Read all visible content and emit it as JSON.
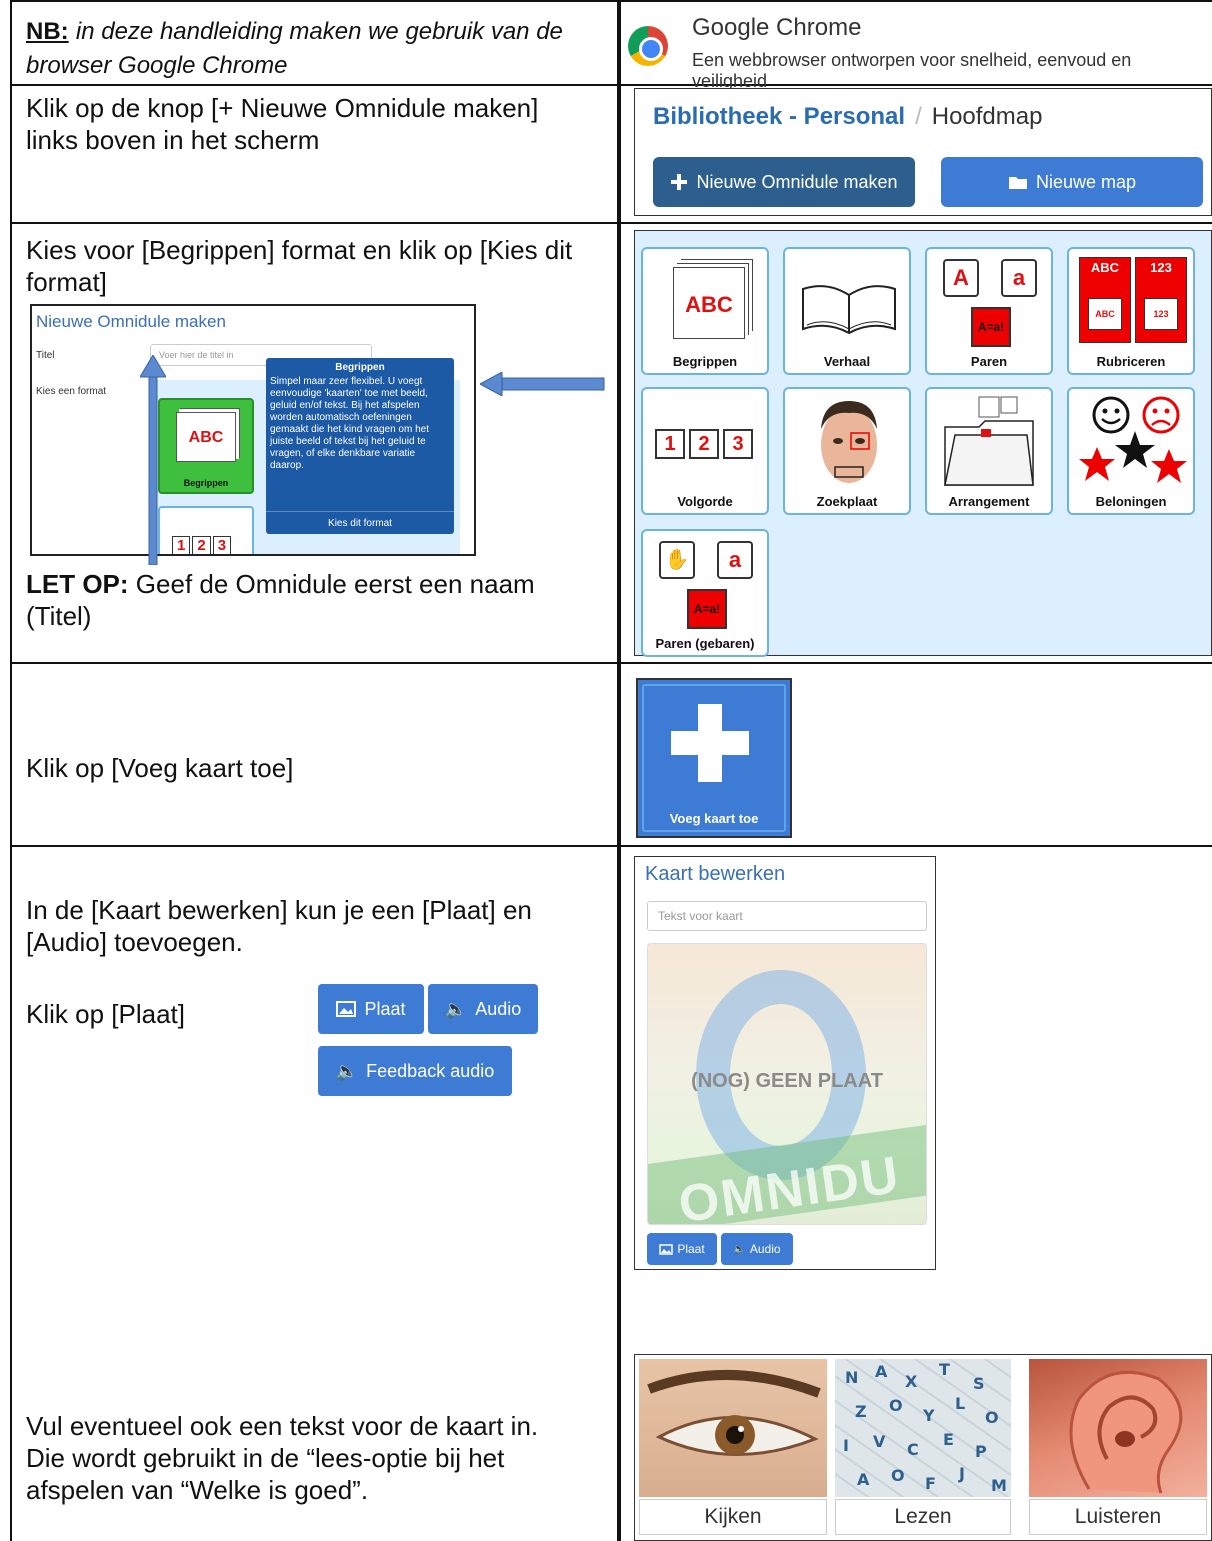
{
  "row1": {
    "nb_label": "NB:",
    "nb_text_line1": "in deze handleiding maken we gebruik van de",
    "nb_text_line2": "browser Google Chrome",
    "chrome_title": "Google Chrome",
    "chrome_subtitle": "Een webbrowser ontworpen voor snelheid, eenvoud en veiligheid"
  },
  "row2": {
    "instruction_line1": "Klik op de knop [+ Nieuwe Omnidule maken]",
    "instruction_line2": "links boven in het scherm",
    "breadcrumb_library": "Bibliotheek - Personal",
    "breadcrumb_sep": "/",
    "breadcrumb_current": "Hoofdmap",
    "new_omnidule_button": "Nieuwe Omnidule maken",
    "new_folder_button": "Nieuwe map"
  },
  "row3": {
    "instruction_line1": "Kies voor [Begrippen] format en klik op [Kies dit",
    "instruction_line2": "format]",
    "note_label": "LET OP:",
    "note_text_line1": "Geef de Omnidule eerst een naam",
    "note_text_line2": "(Titel)",
    "mini_title": "Nieuwe Omnidule maken",
    "mini_label_title": "Titel",
    "mini_placeholder": "Voer hier de titel in",
    "mini_label_format": "Kies een format",
    "mini_card_label": "Begrippen",
    "mini_card_text": "ABC",
    "mini_numbers": [
      "1",
      "2",
      "3"
    ],
    "tooltip_title": "Begrippen",
    "tooltip_body": "Simpel maar zeer flexibel. U voegt eenvoudige 'kaarten' toe met beeld, geluid en/of tekst. Bij het afspelen worden automatisch oefeningen gemaakt die het kind vragen om het juiste beeld of tekst bij het geluid te vragen, of elke denkbare variatie daarop.",
    "tooltip_button": "Kies dit format",
    "formats": [
      {
        "label": "Begrippen",
        "icon": "abc-cards-icon"
      },
      {
        "label": "Verhaal",
        "icon": "open-book-icon"
      },
      {
        "label": "Paren",
        "icon": "pairs-icon"
      },
      {
        "label": "Rubriceren",
        "icon": "categorize-icon"
      },
      {
        "label": "Volgorde",
        "icon": "sequence-icon"
      },
      {
        "label": "Zoekplaat",
        "icon": "face-search-icon"
      },
      {
        "label": "Arrangement",
        "icon": "folder-arrangement-icon"
      },
      {
        "label": "Beloningen",
        "icon": "smiley-stars-icon"
      },
      {
        "label": "Paren (gebaren)",
        "icon": "pairs-gestures-icon"
      }
    ],
    "card_texts": {
      "abc": "ABC",
      "pair_upper": "A",
      "pair_lower": "a",
      "pair_red": "A=a!",
      "rub_abc": "ABC",
      "rub_123": "123",
      "seq": [
        "1",
        "2",
        "3"
      ]
    }
  },
  "row4": {
    "instruction": "Klik op [Voeg kaart toe]",
    "add_card_label": "Voeg kaart toe"
  },
  "row5": {
    "instruction_line1": "In de [Kaart bewerken]  kun je een [Plaat] en",
    "instruction_line2": "[Audio] toevoegen.",
    "instruction_click": "Klik op [Plaat]",
    "btn_plaat": "Plaat",
    "btn_audio": "Audio",
    "btn_feedback": "Feedback audio",
    "edit_title": "Kaart bewerken",
    "edit_placeholder": "Tekst voor kaart",
    "no_image": "(NOG) GEEN PLAAT",
    "ghost_text": "OMNIDU"
  },
  "row6": {
    "text_line1": "Vul eventueel ook een tekst voor de kaart in.",
    "text_line2": "Die wordt gebruikt in de “lees-optie bij het",
    "text_line3": "afspelen van “Welke is goed”.",
    "captions": [
      "Kijken",
      "Lezen",
      "Luisteren"
    ]
  },
  "colors": {
    "accent_blue": "#3d7bd4",
    "dark_blue": "#2d5f8e",
    "format_bg": "#dcefff",
    "card_border": "#6cb4e0"
  }
}
